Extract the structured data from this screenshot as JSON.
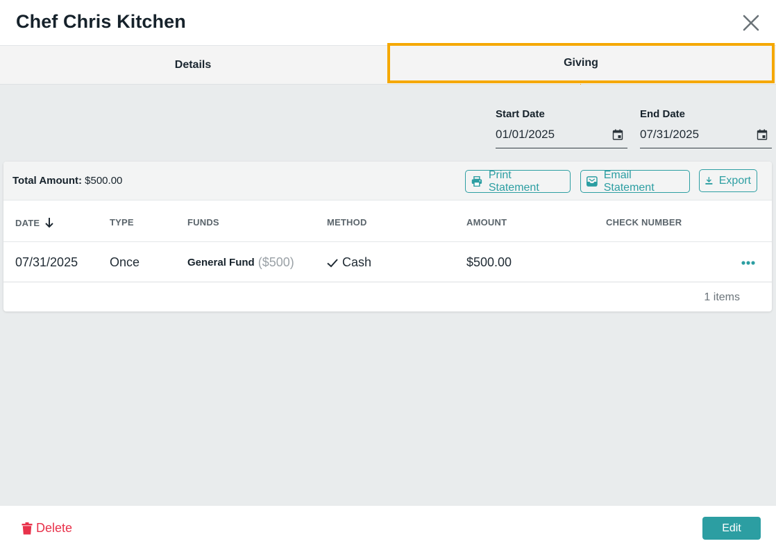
{
  "header": {
    "title": "Chef Chris Kitchen",
    "close_icon": "close-icon"
  },
  "tabs": [
    {
      "label": "Details",
      "active": false
    },
    {
      "label": "Giving",
      "active": true
    }
  ],
  "filters": {
    "start_date": {
      "label": "Start Date",
      "value": "01/01/2025",
      "icon": "calendar-icon"
    },
    "end_date": {
      "label": "End Date",
      "value": "07/31/2025",
      "icon": "calendar-icon"
    }
  },
  "summary": {
    "total_label": "Total Amount:",
    "total_value": "$500.00"
  },
  "actions": {
    "print": {
      "label": "Print Statement",
      "icon": "printer-icon"
    },
    "email": {
      "label": "Email Statement",
      "icon": "envelope-icon"
    },
    "export": {
      "label": "Export",
      "icon": "download-icon"
    }
  },
  "table": {
    "columns": [
      "DATE",
      "TYPE",
      "FUNDS",
      "METHOD",
      "AMOUNT",
      "CHECK NUMBER"
    ],
    "sort": {
      "column": "DATE",
      "direction": "descending",
      "icon": "arrow-down-icon"
    },
    "rows": [
      {
        "date": "07/31/2025",
        "type": "Once",
        "fund_name": "General Fund",
        "fund_amount": "($500)",
        "method": "Cash",
        "method_icon": "check-icon",
        "amount": "$500.00",
        "check_number": "",
        "more_icon": "more-horizontal-icon"
      }
    ],
    "item_count": "1 items"
  },
  "footer": {
    "delete_label": "Delete",
    "delete_icon": "trash-icon",
    "edit_label": "Edit"
  },
  "colors": {
    "accent": "#2c9ea2",
    "highlight": "#f5a800",
    "danger": "#e8314a"
  }
}
